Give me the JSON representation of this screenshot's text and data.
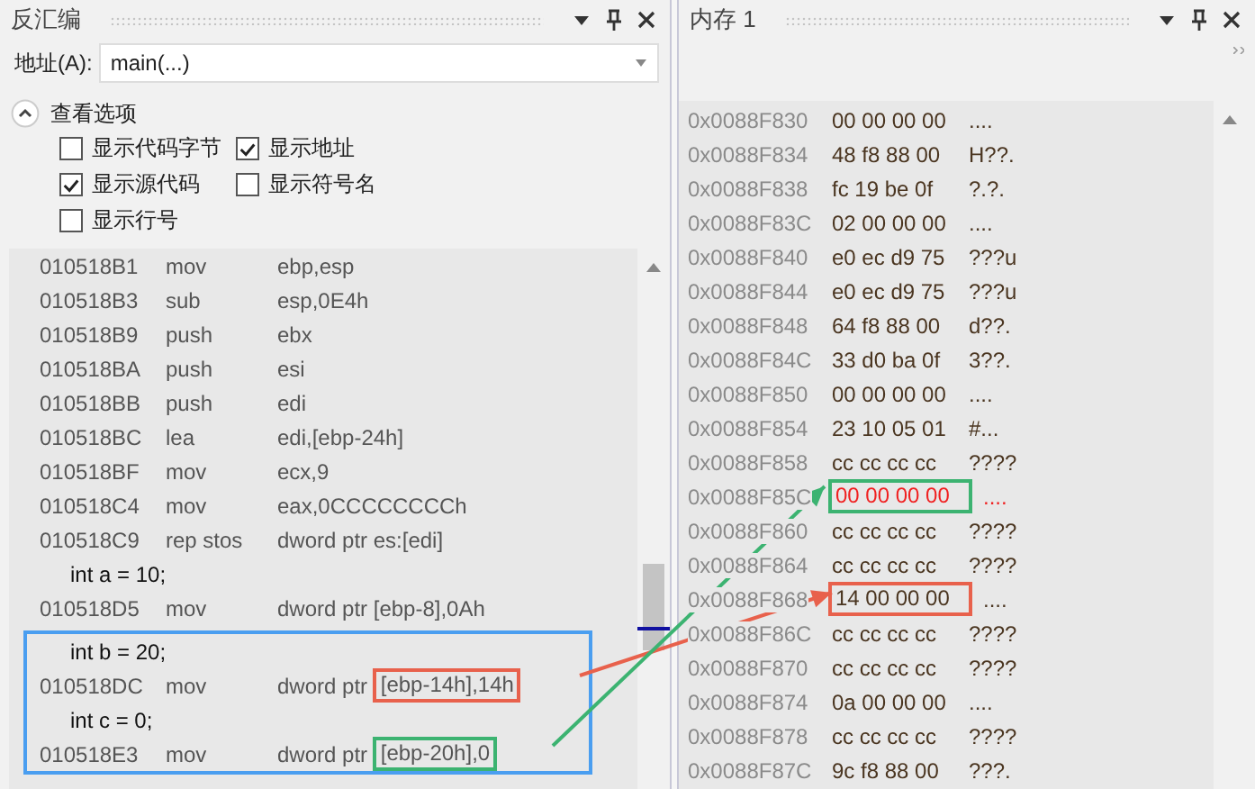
{
  "disassembly": {
    "title": "反汇编",
    "address_label": "地址(A):",
    "address_value": "main(...)",
    "options_title": "查看选项",
    "options_expanded": true,
    "options": [
      {
        "label": "显示代码字节",
        "checked": false
      },
      {
        "label": "显示地址",
        "checked": true
      },
      {
        "label": "显示源代码",
        "checked": true
      },
      {
        "label": "显示符号名",
        "checked": false
      },
      {
        "label": "显示行号",
        "checked": false
      }
    ],
    "lines": [
      {
        "kind": "asm",
        "address": "010518B1",
        "mnemonic": "mov",
        "operand": "ebp,esp"
      },
      {
        "kind": "asm",
        "address": "010518B3",
        "mnemonic": "sub",
        "operand": "esp,0E4h"
      },
      {
        "kind": "asm",
        "address": "010518B9",
        "mnemonic": "push",
        "operand": "ebx"
      },
      {
        "kind": "asm",
        "address": "010518BA",
        "mnemonic": "push",
        "operand": "esi"
      },
      {
        "kind": "asm",
        "address": "010518BB",
        "mnemonic": "push",
        "operand": "edi"
      },
      {
        "kind": "asm",
        "address": "010518BC",
        "mnemonic": "lea",
        "operand": "edi,[ebp-24h]"
      },
      {
        "kind": "asm",
        "address": "010518BF",
        "mnemonic": "mov",
        "operand": "ecx,9"
      },
      {
        "kind": "asm",
        "address": "010518C4",
        "mnemonic": "mov",
        "operand": "eax,0CCCCCCCCh"
      },
      {
        "kind": "asm",
        "address": "010518C9",
        "mnemonic": "rep stos",
        "operand": "dword ptr es:[edi]"
      },
      {
        "kind": "source",
        "text": "int a = 10;"
      },
      {
        "kind": "asm",
        "address": "010518D5",
        "mnemonic": "mov",
        "operand": "dword ptr [ebp-8],0Ah"
      }
    ],
    "boxed_lines": [
      {
        "kind": "source",
        "text": "int b = 20;"
      },
      {
        "kind": "asm",
        "address": "010518DC",
        "mnemonic": "mov",
        "operand": "dword ptr ",
        "marked_operand": "[ebp-14h],14h",
        "color": "#e8614c"
      },
      {
        "kind": "source",
        "text": "int c = 0;"
      },
      {
        "kind": "asm",
        "address": "010518E3",
        "mnemonic": "mov",
        "operand": "dword ptr ",
        "marked_operand": "[ebp-20h],0",
        "color": "#3cb371"
      }
    ]
  },
  "memory": {
    "title": "内存 1",
    "rows": [
      {
        "address": "0x0088F830",
        "bytes": "00 00 00 00",
        "ascii": "....",
        "changed": false
      },
      {
        "address": "0x0088F834",
        "bytes": "48 f8 88 00",
        "ascii": "H??.",
        "changed": false
      },
      {
        "address": "0x0088F838",
        "bytes": "fc 19 be 0f",
        "ascii": "?.?.",
        "changed": false
      },
      {
        "address": "0x0088F83C",
        "bytes": "02 00 00 00",
        "ascii": "....",
        "changed": false
      },
      {
        "address": "0x0088F840",
        "bytes": "e0 ec d9 75",
        "ascii": "???u",
        "changed": false
      },
      {
        "address": "0x0088F844",
        "bytes": "e0 ec d9 75",
        "ascii": "???u",
        "changed": false
      },
      {
        "address": "0x0088F848",
        "bytes": "64 f8 88 00",
        "ascii": "d??.",
        "changed": false
      },
      {
        "address": "0x0088F84C",
        "bytes": "33 d0 ba 0f",
        "ascii": "3??.",
        "changed": false
      },
      {
        "address": "0x0088F850",
        "bytes": "00 00 00 00",
        "ascii": "....",
        "changed": false
      },
      {
        "address": "0x0088F854",
        "bytes": "23 10 05 01",
        "ascii": "#...",
        "changed": false
      },
      {
        "address": "0x0088F858",
        "bytes": "cc cc cc cc",
        "ascii": "????",
        "changed": false
      },
      {
        "address": "0x0088F85C",
        "bytes": "00 00 00 00",
        "ascii": "....",
        "changed": true,
        "color": "#3cb371"
      },
      {
        "address": "0x0088F860",
        "bytes": "cc cc cc cc",
        "ascii": "????",
        "changed": false
      },
      {
        "address": "0x0088F864",
        "bytes": "cc cc cc cc",
        "ascii": "????",
        "changed": false
      },
      {
        "address": "0x0088F868",
        "bytes": "14 00 00 00",
        "ascii": "....",
        "changed": false,
        "color": "#e8614c"
      },
      {
        "address": "0x0088F86C",
        "bytes": "cc cc cc cc",
        "ascii": "????",
        "changed": false
      },
      {
        "address": "0x0088F870",
        "bytes": "cc cc cc cc",
        "ascii": "????",
        "changed": false
      },
      {
        "address": "0x0088F874",
        "bytes": "0a 00 00 00",
        "ascii": "....",
        "changed": false
      },
      {
        "address": "0x0088F878",
        "bytes": "cc cc cc cc",
        "ascii": "????",
        "changed": false
      },
      {
        "address": "0x0088F87C",
        "bytes": "9c f8 88 00",
        "ascii": "???.",
        "changed": false
      }
    ]
  },
  "arrows": [
    {
      "color": "#e8614c"
    },
    {
      "color": "#3cb371"
    }
  ]
}
